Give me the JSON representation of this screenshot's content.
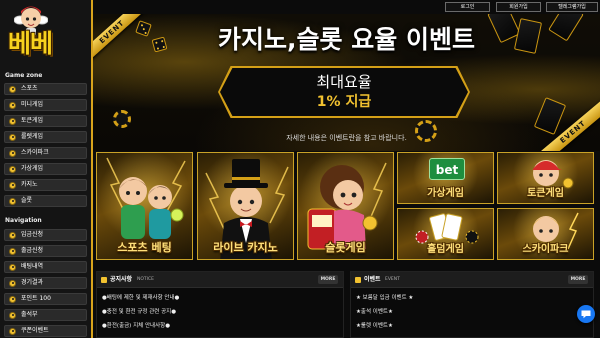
{
  "colors": {
    "accent": "#f2c230",
    "sidebar": "#141414",
    "menu_item": "#2a2a2a",
    "background": "#0b0b0b",
    "chat": "#1877f2",
    "bet_badge": "#1e8e3e"
  },
  "brand": {
    "logo_text": "베베",
    "mascot": "cupid-mascot-icon"
  },
  "header": {
    "buttons": [
      {
        "label": "로그인"
      },
      {
        "label": "회원가입"
      },
      {
        "label": "텔레그램가입"
      }
    ]
  },
  "sidebar": {
    "game_zone_label": "Game zone",
    "game_items": [
      {
        "label": "스포츠",
        "icon": "sports-icon"
      },
      {
        "label": "미니게임",
        "icon": "mini-game-icon"
      },
      {
        "label": "토큰게임",
        "icon": "token-game-icon"
      },
      {
        "label": "룰렛게임",
        "icon": "roulette-icon"
      },
      {
        "label": "스카이파크",
        "icon": "skypark-icon"
      },
      {
        "label": "가상게임",
        "icon": "virtual-game-icon"
      },
      {
        "label": "카지노",
        "icon": "casino-icon"
      },
      {
        "label": "슬롯",
        "icon": "slot-icon"
      }
    ],
    "navigation_label": "Navigation",
    "nav_items": [
      {
        "label": "입금신청",
        "icon": "deposit-icon"
      },
      {
        "label": "출금신청",
        "icon": "withdraw-icon"
      },
      {
        "label": "배팅내역",
        "icon": "bet-history-icon"
      },
      {
        "label": "경기결과",
        "icon": "match-result-icon"
      },
      {
        "label": "포인트 100",
        "icon": "point-icon"
      },
      {
        "label": "출석부",
        "icon": "attendance-icon"
      },
      {
        "label": "쿠폰이벤트",
        "icon": "coupon-icon"
      }
    ]
  },
  "banner": {
    "ribbon_left": "EVENT",
    "title": "카지노,슬롯 요율 이벤트",
    "box_line1": "최대요율",
    "box_line2": "1% 지급",
    "subtitle": "자세한 내용은 이벤트란을 참고 바랍니다.",
    "ribbon_right": "EVENT"
  },
  "games": {
    "large": [
      {
        "label": "스포츠 베팅"
      },
      {
        "label": "라이브 카지노"
      },
      {
        "label": "슬롯게임"
      }
    ],
    "small": [
      {
        "label": "가상게임",
        "badge": "bet"
      },
      {
        "label": "토큰게임"
      },
      {
        "label": "홀덤게임"
      },
      {
        "label": "스카이파크"
      }
    ]
  },
  "notice": {
    "title": "공지사항",
    "subtitle": "NOTICE",
    "more": "MORE",
    "items": [
      "●배팅에 제한 및 제재사항 안내●",
      "●충전 및 환전 규정 관련 공지●",
      "●환전(출금) 지체 안내사항●"
    ]
  },
  "events": {
    "title": "이벤트",
    "subtitle": "EVENT",
    "more": "MORE",
    "items": [
      "★ 보름달 입금 이벤트 ★",
      "★출석 이벤트★",
      "★룰렛 이벤트★"
    ]
  },
  "chat": {
    "icon": "chat-bubble-icon"
  }
}
